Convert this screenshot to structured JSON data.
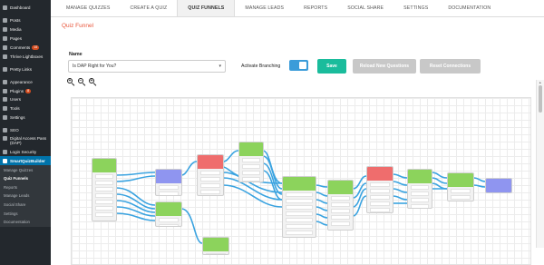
{
  "sidebar": {
    "items": [
      {
        "label": "Dashboard"
      },
      {
        "label": "Posts"
      },
      {
        "label": "Media"
      },
      {
        "label": "Pages"
      },
      {
        "label": "Comments",
        "badge": "15"
      },
      {
        "label": "Thrive Lightboxes"
      },
      {
        "label": "Pretty Links"
      },
      {
        "label": "Appearance"
      },
      {
        "label": "Plugins",
        "badge": "8"
      },
      {
        "label": "Users"
      },
      {
        "label": "Tools"
      },
      {
        "label": "Settings"
      },
      {
        "label": "SEO"
      },
      {
        "label": "Digital Access Pass (DAP)"
      },
      {
        "label": "Login Security"
      },
      {
        "label": "SmartQuizBuilder"
      }
    ],
    "submenu": [
      {
        "label": "Manage Quizzes"
      },
      {
        "label": "Quiz Funnels"
      },
      {
        "label": "Reports"
      },
      {
        "label": "Manage Leads"
      },
      {
        "label": "Social Share"
      },
      {
        "label": "Settings"
      },
      {
        "label": "Documentation"
      }
    ]
  },
  "tabs": [
    {
      "label": "MANAGE QUIZZES"
    },
    {
      "label": "CREATE A QUIZ"
    },
    {
      "label": "QUIZ FUNNELS",
      "active": true
    },
    {
      "label": "MANAGE LEADS"
    },
    {
      "label": "REPORTS"
    },
    {
      "label": "SOCIAL SHARE"
    },
    {
      "label": "SETTINGS"
    },
    {
      "label": "DOCUMENTATION"
    }
  ],
  "page": {
    "title": "Quiz Funnel",
    "name_label": "Name",
    "quiz_name": "Is DAP Right for You?",
    "activate_branching_label": "Activate Branching",
    "branching_enabled": true,
    "save_label": "Save",
    "reload_label": "Reload New Questions",
    "reset_label": "Reset Connections"
  },
  "icons": {
    "zoom_in": "zoom-in-icon",
    "zoom_out": "zoom-out-icon",
    "zoom_reset": "zoom-reset-icon"
  },
  "colors": {
    "accent": "#1abc9c",
    "toggle": "#3b9cd9",
    "title": "#e8553a",
    "connector": "#3aa3e0",
    "question_node": "#8cd35c",
    "result_node": "#8f95f0",
    "end_node": "#ef6d6d"
  }
}
